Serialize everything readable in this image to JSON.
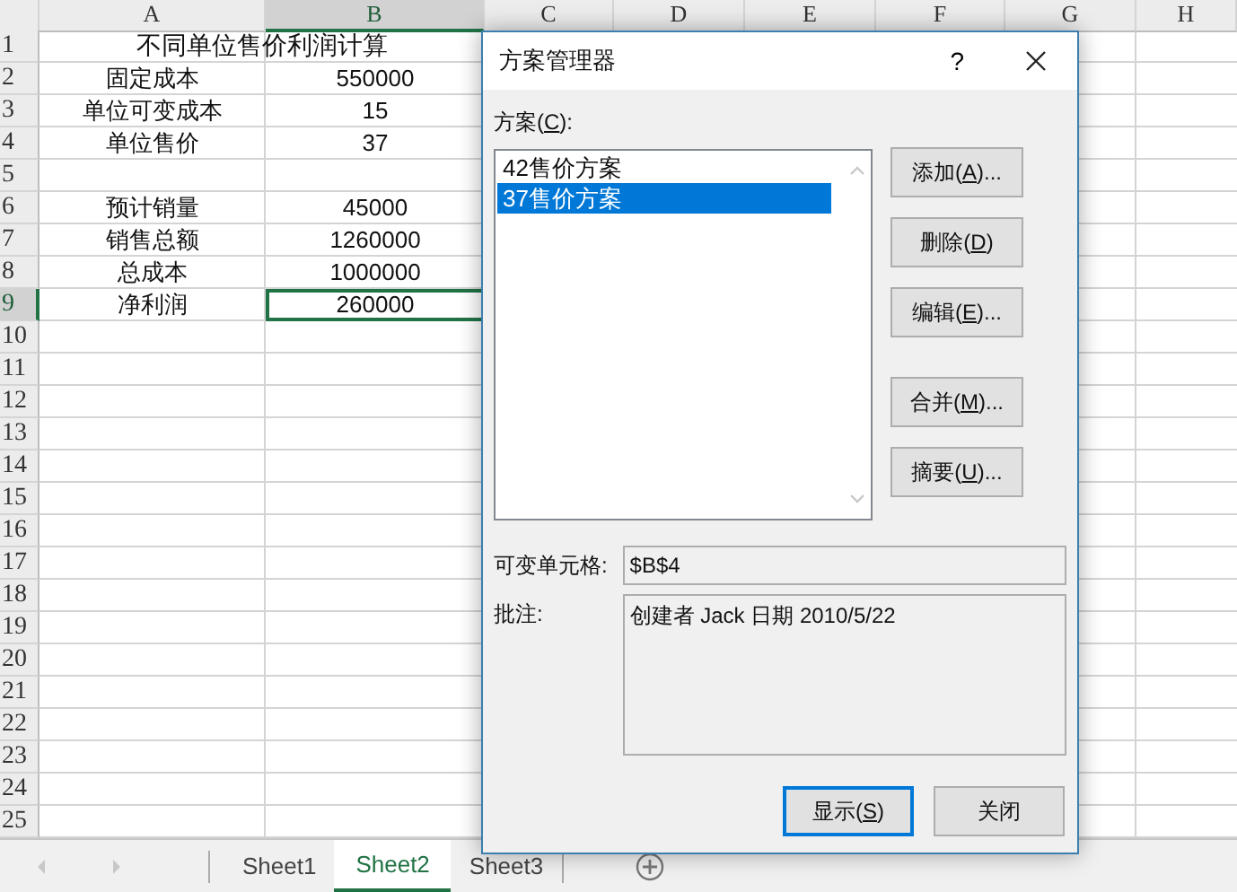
{
  "spreadsheet": {
    "column_headers": [
      {
        "label": "A",
        "selected": false
      },
      {
        "label": "B",
        "selected": true
      },
      {
        "label": "C",
        "selected": false
      },
      {
        "label": "D",
        "selected": false
      },
      {
        "label": "E",
        "selected": false
      },
      {
        "label": "F",
        "selected": false
      },
      {
        "label": "G",
        "selected": false
      },
      {
        "label": "H",
        "selected": false
      }
    ],
    "rows": [
      {
        "number": "1",
        "selected": false,
        "cells": [
          {
            "kind": "merged",
            "text": "不同单位售价利润计算",
            "selected": false
          }
        ]
      },
      {
        "number": "2",
        "selected": false,
        "cells": [
          {
            "kind": "cell",
            "text": "固定成本",
            "selected": false
          },
          {
            "kind": "cell",
            "text": "550000",
            "selected": false
          }
        ]
      },
      {
        "number": "3",
        "selected": false,
        "cells": [
          {
            "kind": "cell",
            "text": "单位可变成本",
            "selected": false
          },
          {
            "kind": "cell",
            "text": "15",
            "selected": false
          }
        ]
      },
      {
        "number": "4",
        "selected": false,
        "cells": [
          {
            "kind": "cell",
            "text": "单位售价",
            "selected": false
          },
          {
            "kind": "cell",
            "text": "37",
            "selected": false
          }
        ]
      },
      {
        "number": "5",
        "selected": false
      },
      {
        "number": "6",
        "selected": false,
        "cells": [
          {
            "kind": "cell",
            "text": "预计销量",
            "selected": false
          },
          {
            "kind": "cell",
            "text": "45000",
            "selected": false
          }
        ]
      },
      {
        "number": "7",
        "selected": false,
        "cells": [
          {
            "kind": "cell",
            "text": "销售总额",
            "selected": false
          },
          {
            "kind": "cell",
            "text": "1260000",
            "selected": false
          }
        ]
      },
      {
        "number": "8",
        "selected": false,
        "cells": [
          {
            "kind": "cell",
            "text": "总成本",
            "selected": false
          },
          {
            "kind": "cell",
            "text": "1000000",
            "selected": false
          }
        ]
      },
      {
        "number": "9",
        "selected": true,
        "cells": [
          {
            "kind": "cell",
            "text": "净利润",
            "selected": false
          },
          {
            "kind": "cell",
            "text": "260000",
            "selected": true
          }
        ]
      },
      {
        "number": "10",
        "selected": false
      },
      {
        "number": "11",
        "selected": false
      },
      {
        "number": "12",
        "selected": false
      },
      {
        "number": "13",
        "selected": false
      },
      {
        "number": "14",
        "selected": false
      },
      {
        "number": "15",
        "selected": false
      },
      {
        "number": "16",
        "selected": false
      },
      {
        "number": "17",
        "selected": false
      },
      {
        "number": "18",
        "selected": false
      },
      {
        "number": "19",
        "selected": false
      },
      {
        "number": "20",
        "selected": false
      },
      {
        "number": "21",
        "selected": false
      },
      {
        "number": "22",
        "selected": false
      },
      {
        "number": "23",
        "selected": false
      },
      {
        "number": "24",
        "selected": false
      },
      {
        "number": "25",
        "selected": false
      }
    ],
    "sheet_tabs": [
      {
        "label": "Sheet1",
        "selected": false
      },
      {
        "label": "Sheet2",
        "selected": true
      },
      {
        "label": "Sheet3",
        "selected": false
      }
    ]
  },
  "dialog": {
    "title": "方案管理器",
    "help": "?",
    "list_label": {
      "text": "方案(",
      "key": "C",
      "after": "):"
    },
    "scenarios": [
      {
        "name": "42售价方案",
        "selected": false
      },
      {
        "name": "37售价方案",
        "selected": true
      }
    ],
    "button_groups": [
      [
        {
          "text": "添加(",
          "key": "A",
          "after": ")..."
        },
        {
          "text": "删除(",
          "key": "D",
          "after": ")"
        },
        {
          "text": "编辑(",
          "key": "E",
          "after": ")..."
        }
      ],
      [
        {
          "text": "合并(",
          "key": "M",
          "after": ")..."
        },
        {
          "text": "摘要(",
          "key": "U",
          "after": ")..."
        }
      ]
    ],
    "changing_cells_label": "可变单元格:",
    "changing_cells": "$B$4",
    "comment_label": "批注:",
    "comment": "创建者 Jack 日期 2010/5/22",
    "footer_buttons": [
      {
        "text": "显示(",
        "key": "S",
        "after": ")",
        "default": true
      },
      {
        "text": "关闭",
        "default": false
      }
    ]
  }
}
